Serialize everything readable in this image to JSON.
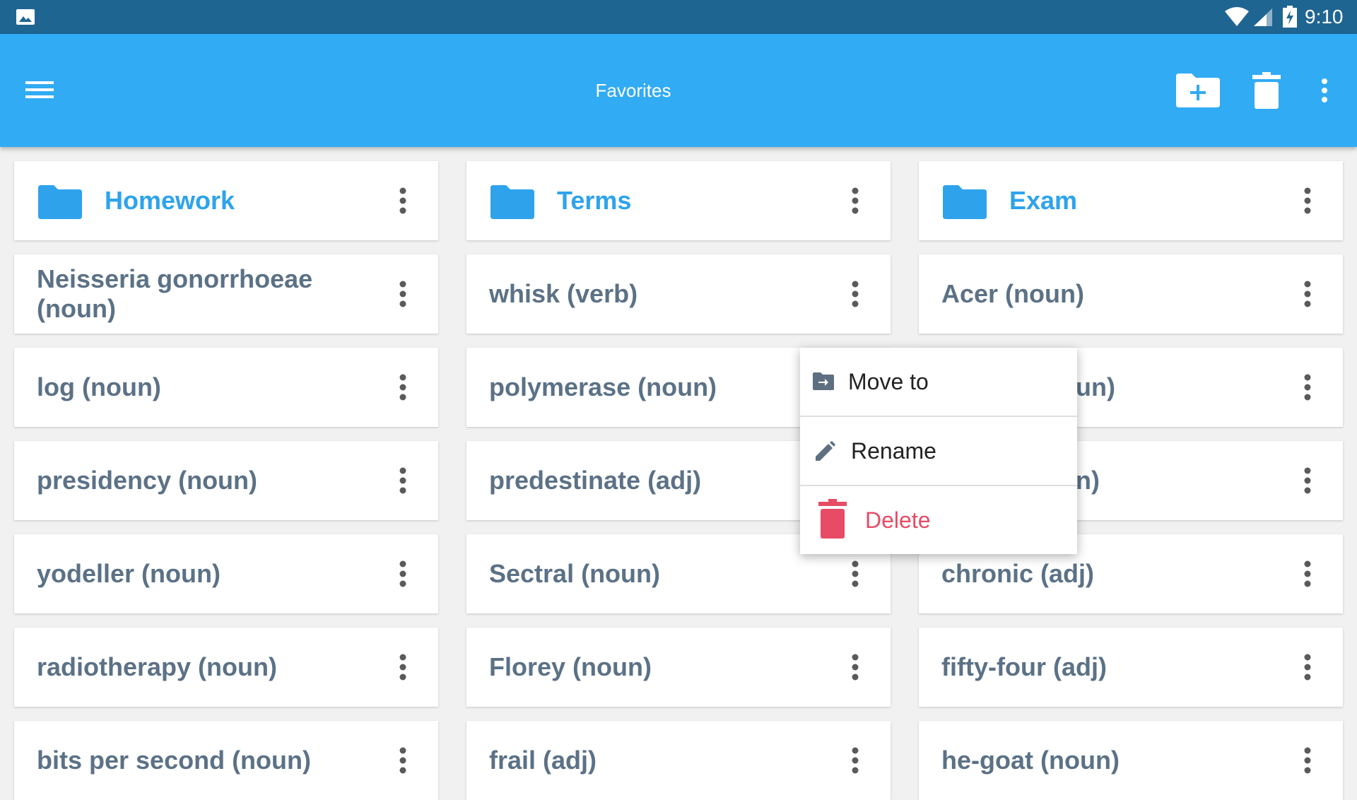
{
  "status_bar": {
    "time": "9:10"
  },
  "app_bar": {
    "title": "Favorites"
  },
  "folders": [
    {
      "label": "Homework"
    },
    {
      "label": "Terms"
    },
    {
      "label": "Exam"
    }
  ],
  "terms": {
    "col1": [
      "Neisseria gonorrhoeae (noun)",
      "log (noun)",
      "presidency (noun)",
      "yodeller (noun)",
      "radiotherapy (noun)",
      "bits per second (noun)"
    ],
    "col2": [
      "whisk (verb)",
      "polymerase (noun)",
      "predestinate (adj)",
      "Sectral (noun)",
      "Florey (noun)",
      "frail (adj)"
    ],
    "col3": [
      "Acer (noun)",
      "un)",
      "n)",
      "chronic (adj)",
      "fifty-four (adj)",
      "he-goat (noun)"
    ]
  },
  "context_menu": {
    "move_to": "Move to",
    "rename": "Rename",
    "delete": "Delete"
  },
  "colors": {
    "status_bar": "#1f6592",
    "app_bar": "#31abf4",
    "folder_text": "#2ea3ec",
    "term_text": "#5b7186",
    "delete": "#e64c65"
  }
}
